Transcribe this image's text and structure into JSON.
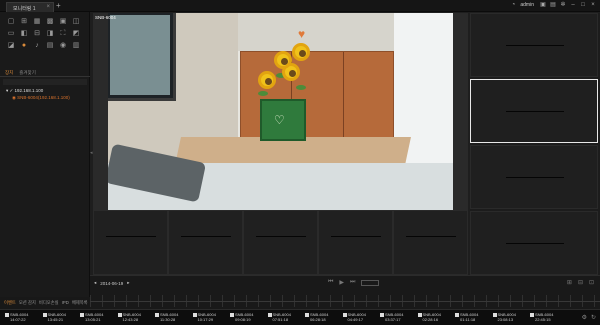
{
  "tab": {
    "label": "모니터링 1",
    "close": "×",
    "add": "+"
  },
  "header": {
    "user": "admin",
    "icons": [
      "user-icon",
      "lock-icon",
      "folder-icon",
      "settings-icon",
      "minimize-icon",
      "maximize-icon",
      "close-icon"
    ]
  },
  "toolbar": {
    "tools": [
      {
        "name": "layout-1x1-icon",
        "glyph": "▢"
      },
      {
        "name": "layout-2x2-icon",
        "glyph": "⊞"
      },
      {
        "name": "layout-3x3-icon",
        "glyph": "▦"
      },
      {
        "name": "layout-4x4-icon",
        "glyph": "▩"
      },
      {
        "name": "layout-1plus5-icon",
        "glyph": "▣"
      },
      {
        "name": "layout-custom-icon",
        "glyph": "◫"
      },
      {
        "name": "layout-wide-icon",
        "glyph": "▭"
      },
      {
        "name": "layout-split-icon",
        "glyph": "◧"
      },
      {
        "name": "layout-grid-icon",
        "glyph": "⊟"
      },
      {
        "name": "sequence-icon",
        "glyph": "◨"
      },
      {
        "name": "fullscreen-icon",
        "glyph": "⛶"
      },
      {
        "name": "aspect-icon",
        "glyph": "◩"
      },
      {
        "name": "snapshot-icon",
        "glyph": "◪"
      },
      {
        "name": "record-icon",
        "glyph": "●"
      },
      {
        "name": "audio-icon",
        "glyph": "♪"
      },
      {
        "name": "pip-icon",
        "glyph": "▤"
      },
      {
        "name": "ptz-icon",
        "glyph": "◉"
      },
      {
        "name": "layout-3x4-icon",
        "glyph": "▥"
      }
    ]
  },
  "panel_tabs": [
    {
      "label": "장치",
      "active": true
    },
    {
      "label": "즐겨찾기",
      "active": false
    }
  ],
  "tree": {
    "root": "▾ ✓  192.168.1.100",
    "child": "◉  SNB-6004(192.168.1.100)"
  },
  "main_video": {
    "label": "SNB-6004"
  },
  "filters": [
    {
      "label": "이벤트",
      "active": true
    },
    {
      "label": "모션 감지",
      "active": false
    },
    {
      "label": "비디오손실",
      "active": false
    },
    {
      "label": "IPD",
      "active": false
    },
    {
      "label": "배제목록",
      "active": false
    }
  ],
  "timeline": {
    "date": "2014-06-19",
    "prev": "◂",
    "next": "▸",
    "controls": [
      "⏮",
      "▶",
      "⏭"
    ],
    "right_icons": [
      "⊞",
      "⊟",
      "⊡"
    ]
  },
  "events": [
    {
      "cam": "SNB-6004",
      "time": "14:07:22"
    },
    {
      "cam": "SNB-6004",
      "time": "13:45:21"
    },
    {
      "cam": "SNB-6004",
      "time": "13:05:21"
    },
    {
      "cam": "SNB-6004",
      "time": "12:43:28"
    },
    {
      "cam": "SNB-6004",
      "time": "11:30:28"
    },
    {
      "cam": "SNB-6004",
      "time": "10:17:29"
    },
    {
      "cam": "SNB-6004",
      "time": "09:08:19"
    },
    {
      "cam": "SNB-6004",
      "time": "07:51:18"
    },
    {
      "cam": "SNB-6004",
      "time": "06:28:18"
    },
    {
      "cam": "SNB-6004",
      "time": "04:49:17"
    },
    {
      "cam": "SNB-6004",
      "time": "03:37:17"
    },
    {
      "cam": "SNB-6004",
      "time": "02:28:16"
    },
    {
      "cam": "SNB-6004",
      "time": "01:11:18"
    },
    {
      "cam": "SNB-6004",
      "time": "23:08:13"
    },
    {
      "cam": "SNB-6004",
      "time": "22:45:15"
    }
  ]
}
